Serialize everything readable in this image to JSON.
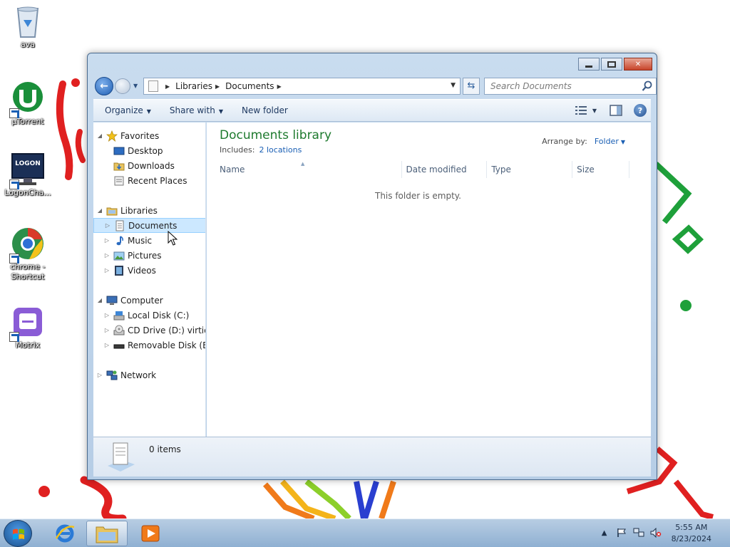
{
  "desktop": {
    "icons": [
      {
        "label": "ava"
      },
      {
        "label": "µTorrent"
      },
      {
        "label": "LogonCha..."
      },
      {
        "label": "chrome - Shortcut"
      },
      {
        "label": "Motrix"
      }
    ],
    "logon_icon_text": "LOGON"
  },
  "window": {
    "address": {
      "crumbs": [
        "Libraries",
        "Documents"
      ]
    },
    "search": {
      "placeholder": "Search Documents"
    },
    "commands": {
      "organize": "Organize",
      "share_with": "Share with",
      "new_folder": "New folder"
    },
    "nav": {
      "favorites": "Favorites",
      "desktop": "Desktop",
      "downloads": "Downloads",
      "recent_places": "Recent Places",
      "libraries": "Libraries",
      "documents": "Documents",
      "music": "Music",
      "pictures": "Pictures",
      "videos": "Videos",
      "computer": "Computer",
      "local_disk": "Local Disk (C:)",
      "cd_drive": "CD Drive (D:) virtio-w",
      "removable_disk": "Removable Disk (E:)",
      "network": "Network"
    },
    "content": {
      "title": "Documents library",
      "includes_label": "Includes:",
      "includes_link": "2 locations",
      "arrange_label": "Arrange by:",
      "arrange_value": "Folder",
      "columns": {
        "name": "Name",
        "date_modified": "Date modified",
        "type": "Type",
        "size": "Size"
      },
      "empty_message": "This folder is empty."
    },
    "details": {
      "item_count": "0 items"
    }
  },
  "taskbar": {
    "clock_time": "5:55 AM",
    "clock_date": "8/23/2024"
  },
  "colors": {
    "library_title": "#1e7a2e",
    "link": "#1a5fb4",
    "selection": "#cce8ff"
  }
}
